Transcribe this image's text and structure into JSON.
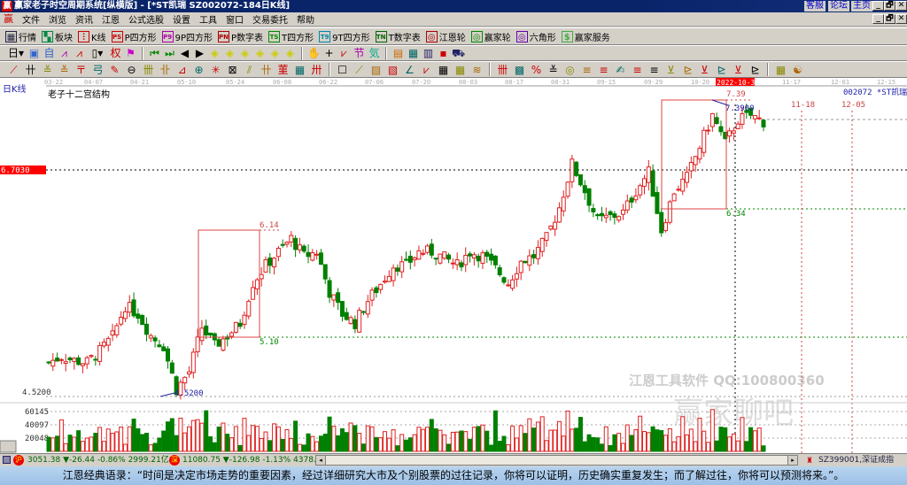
{
  "window": {
    "title": "赢家老子时空周期系统[纵横版] - [*ST凯瑞   SZ002072-184日K线]",
    "logo": "赢",
    "links": [
      "客服",
      "论坛",
      "主页"
    ],
    "controls": [
      "_",
      "🗗",
      "✕"
    ]
  },
  "menu": [
    "文件",
    "浏览",
    "资讯",
    "江恩",
    "公式选股",
    "设置",
    "工具",
    "窗口",
    "交易委托",
    "帮助"
  ],
  "toolbar1": [
    {
      "label": "行情",
      "icon": "quote-icon",
      "glyph": "▦",
      "color": "#224"
    },
    {
      "label": "板块",
      "icon": "sector-icon",
      "glyph": "▚",
      "color": "#084"
    },
    {
      "label": "K线",
      "icon": "kline-icon",
      "glyph": "⫶",
      "color": "#c00"
    },
    {
      "label": "P四方形",
      "icon": "p-square-icon",
      "glyph": "PS",
      "color": "#c00"
    },
    {
      "label": "9P四方形",
      "icon": "9p-square-icon",
      "glyph": "P9",
      "color": "#a0a"
    },
    {
      "label": "P数字表",
      "icon": "p-table-icon",
      "glyph": "PN",
      "color": "#a00"
    },
    {
      "label": "T四方形",
      "icon": "t-square-icon",
      "glyph": "TS",
      "color": "#080"
    },
    {
      "label": "9T四方形",
      "icon": "9t-square-icon",
      "glyph": "T9",
      "color": "#08a"
    },
    {
      "label": "T数字表",
      "icon": "t-table-icon",
      "glyph": "TN",
      "color": "#060"
    },
    {
      "label": "江恩轮",
      "icon": "gann-wheel-icon",
      "glyph": "◎",
      "color": "#a00"
    },
    {
      "label": "赢家轮",
      "icon": "winner-wheel-icon",
      "glyph": "◎",
      "color": "#080"
    },
    {
      "label": "六角形",
      "icon": "hexagon-icon",
      "glyph": "◎",
      "color": "#60a"
    },
    {
      "label": "赢家服务",
      "icon": "service-icon",
      "glyph": "$",
      "color": "#4a4"
    }
  ],
  "toolbar2": [
    {
      "name": "period-day-dropdown",
      "glyph": "日▾",
      "color": "#000"
    },
    {
      "name": "chart-icon",
      "glyph": "▣",
      "color": "#36c"
    },
    {
      "name": "self-icon",
      "glyph": "自",
      "color": "#36c"
    },
    {
      "name": "indicator-a-icon",
      "glyph": "⩘",
      "color": "#a0a"
    },
    {
      "name": "indicator-b-icon",
      "glyph": "⩘",
      "color": "#c00"
    },
    {
      "name": "candle-type-dropdown",
      "glyph": "▯▾",
      "color": "#000"
    },
    {
      "name": "rights-icon",
      "glyph": "权",
      "color": "#c00"
    },
    {
      "name": "flag-icon",
      "glyph": "⚑",
      "color": "#c0c"
    },
    {
      "sep": true
    },
    {
      "name": "first-icon",
      "glyph": "⏮",
      "color": "#080"
    },
    {
      "name": "last-icon",
      "glyph": "⏭",
      "color": "#080"
    },
    {
      "name": "prev-icon",
      "glyph": "◀",
      "color": "#000"
    },
    {
      "name": "next-icon",
      "glyph": "▶",
      "color": "#000"
    },
    {
      "name": "zoom-a-icon",
      "glyph": "◈",
      "color": "#cc0"
    },
    {
      "name": "zoom-b-icon",
      "glyph": "◈",
      "color": "#cc0"
    },
    {
      "name": "zoom-c-icon",
      "glyph": "◈",
      "color": "#cc0"
    },
    {
      "name": "zoom-d-icon",
      "glyph": "◈",
      "color": "#cc0"
    },
    {
      "name": "zoom-e-icon",
      "glyph": "◈",
      "color": "#cc0"
    },
    {
      "name": "zoom-f-icon",
      "glyph": "◈",
      "color": "#cc0"
    },
    {
      "sep": true
    },
    {
      "name": "hand-icon",
      "glyph": "✋",
      "color": "#000"
    },
    {
      "name": "crosshair-icon",
      "glyph": "+",
      "color": "#000"
    },
    {
      "name": "line-tool-icon",
      "glyph": "⩗",
      "color": "#c00"
    },
    {
      "name": "festival-icon",
      "glyph": "节",
      "color": "#a0a"
    },
    {
      "name": "weather-icon",
      "glyph": "気",
      "color": "#0a8"
    },
    {
      "sep": true
    },
    {
      "name": "calendar-icon",
      "glyph": "▤",
      "color": "#c60"
    },
    {
      "name": "calculator-icon",
      "glyph": "▦",
      "color": "#066"
    },
    {
      "name": "notebook-icon",
      "glyph": "▥",
      "color": "#226"
    },
    {
      "name": "save-icon",
      "glyph": "▪",
      "color": "#c00"
    },
    {
      "name": "truck-icon",
      "glyph": "⛟",
      "color": "#226"
    }
  ],
  "toolbar3": [
    "pen-icon",
    "grid-icon",
    "gann-fan-icon",
    "gann-fan2-icon",
    "fork-icon",
    "arc-icon",
    "pencil-icon",
    "circle-icon",
    "parallel-icon",
    "fib-icon",
    "angle-icon",
    "target-icon",
    "star-icon",
    "box-icon",
    "wave-icon",
    "time-icon",
    "square-icon",
    "lines-icon",
    "hline-icon",
    "fan-icon",
    "square-grid-icon",
    "box-grid-icon",
    "angle2-icon",
    "zigzag-icon",
    "grid2-icon",
    "grid3-icon",
    "lines2-icon",
    "chart2-icon",
    "percent-arrow-icon",
    "percent-icon",
    "percent-lines-icon",
    "coin-icon",
    "gold-icon",
    "gold-lines-icon",
    "pen-brush-icon",
    "gold2-icon",
    "gold3-icon",
    "angle3-icon",
    "fib2-icon",
    "angle4-icon",
    "gann-icon",
    "arrow-icon",
    "time2-icon",
    "table-icon",
    "yinyang-icon",
    "infinity-icon"
  ],
  "chart": {
    "period_label": "日K线",
    "indicator_title": "老子十二宫结构",
    "stock_label": "002072 *ST凯瑞",
    "date_ticks": [
      "03-22",
      "04-07",
      "04-21",
      "05-10",
      "05-24",
      "06-08",
      "06-22",
      "07-06",
      "07-20",
      "08-03",
      "08-17",
      "08-31",
      "09-15",
      "09-29",
      "10-20",
      "2022-10-31",
      "11-17",
      "12-01",
      "12-15"
    ],
    "cursor_price": "6.7030",
    "low_axis_label": "4.5200",
    "annotations": {
      "low": "4.5200",
      "high": "7.3900",
      "box1_top": "6.14",
      "box1_bottom": "5.10",
      "box2_top": "7.39",
      "box2_bottom": "6.34",
      "future1": "11-18",
      "future2": "12-05"
    },
    "volume_ticks": [
      "60145",
      "40097",
      "20048"
    ],
    "watermark1": "江恩工具软件  QQ:100800360",
    "watermark2": "赢家聊吧",
    "colors": {
      "up": "#e02020",
      "down": "#008000",
      "highlight": "#ff0000",
      "annotation": "#2020a0"
    }
  },
  "chart_data": {
    "type": "candlestick",
    "price_range": [
      4.52,
      7.39
    ],
    "approx_closes": [
      4.84,
      4.9,
      4.86,
      4.84,
      4.95,
      5.09,
      5.39,
      5.31,
      5.1,
      5.0,
      4.58,
      4.75,
      5.18,
      5.0,
      5.1,
      5.22,
      5.61,
      5.78,
      5.91,
      6.04,
      5.87,
      5.91,
      5.52,
      5.31,
      5.22,
      5.44,
      5.6,
      5.78,
      5.78,
      5.91,
      5.91,
      5.85,
      5.78,
      5.91,
      5.87,
      5.75,
      5.61,
      5.82,
      5.87,
      6.04,
      6.34,
      6.76,
      6.5,
      6.21,
      6.25,
      6.29,
      6.5,
      6.68,
      6.12,
      6.5,
      6.63,
      6.93,
      7.23,
      6.96,
      7.19,
      7.23,
      7.17
    ],
    "volume_max": 60145
  },
  "status": {
    "sh_label": "沪",
    "sh_text": "3051.38 ▼-26.44 -0.86% 2999.21亿",
    "sz_label": "深",
    "sz_text": "11080.75 ▼-126.98 -1.13% 4378.",
    "index_label": "SZ399001,深证成指"
  },
  "quote": "江恩经典语录：“时间是决定市场走势的重要因素，经过详细研究大市及个别股票的过往记录，你将可以证明，历史确实重复发生；而了解过往，你将可以预测将来。”。"
}
